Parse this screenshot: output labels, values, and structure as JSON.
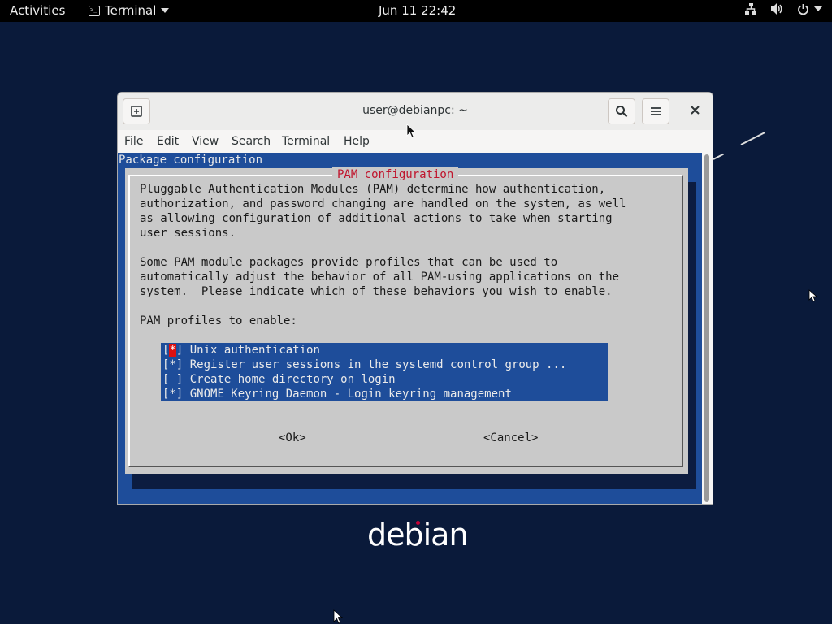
{
  "topbar": {
    "activities": "Activities",
    "app_name": "Terminal",
    "clock": "Jun 11  22:42"
  },
  "window": {
    "title": "user@debianpc: ~",
    "menu": [
      "File",
      "Edit",
      "View",
      "Search",
      "Terminal",
      "Help"
    ]
  },
  "terminal": {
    "header": "Package configuration",
    "dialog": {
      "title": "PAM configuration",
      "description": "Pluggable Authentication Modules (PAM) determine how authentication,\nauthorization, and password changing are handled on the system, as well\nas allowing configuration of additional actions to take when starting\nuser sessions.\n\nSome PAM module packages provide profiles that can be used to\nautomatically adjust the behavior of all PAM-using applications on the\nsystem.  Please indicate which of these behaviors you wish to enable.\n\nPAM profiles to enable:",
      "profiles": [
        {
          "checked": true,
          "label": "Unix authentication",
          "cursor": true
        },
        {
          "checked": true,
          "label": "Register user sessions in the systemd control group ..."
        },
        {
          "checked": false,
          "label": "Create home directory on login"
        },
        {
          "checked": true,
          "label": "GNOME Keyring Daemon - Login keyring management"
        }
      ],
      "ok_label": "<Ok>",
      "cancel_label": "<Cancel>"
    }
  },
  "desktop": {
    "logo_text": "debian"
  }
}
